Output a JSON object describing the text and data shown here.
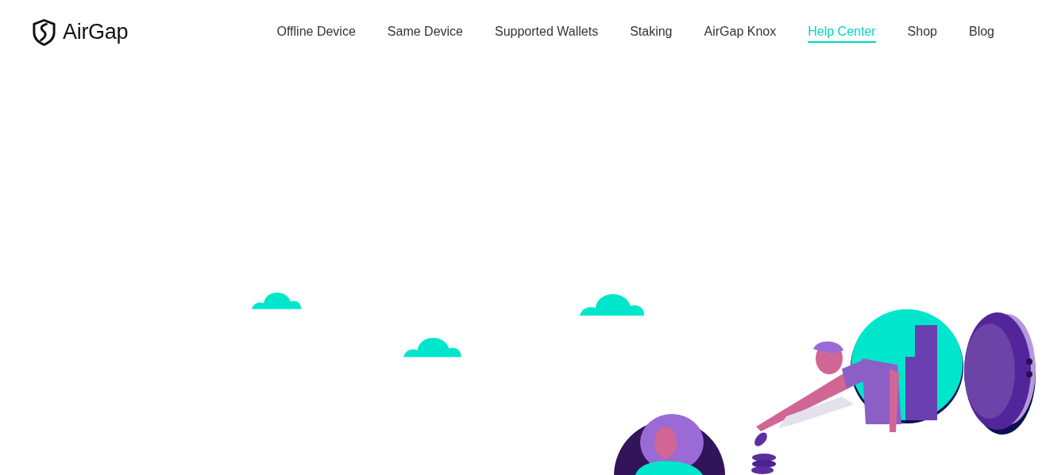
{
  "logo": {
    "text": "AirGap"
  },
  "nav": [
    {
      "label": "Offline Device",
      "selected": false
    },
    {
      "label": "Same Device",
      "selected": false
    },
    {
      "label": "Supported Wallets",
      "selected": false
    },
    {
      "label": "Staking",
      "selected": false
    },
    {
      "label": "AirGap Knox",
      "selected": false
    },
    {
      "label": "Help Center",
      "selected": true
    },
    {
      "label": "Shop",
      "selected": false
    },
    {
      "label": "Blog",
      "selected": false
    }
  ]
}
